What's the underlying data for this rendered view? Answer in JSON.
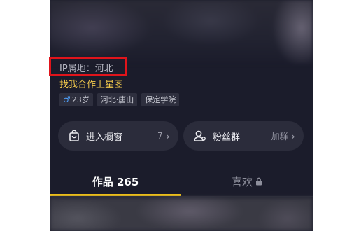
{
  "profile": {
    "ip_location": "IP属地：河北",
    "bio": "找我合作上星图",
    "tags": [
      {
        "icon": "male-icon",
        "text": "23岁"
      },
      {
        "text": "河北·唐山"
      },
      {
        "text": "保定学院"
      }
    ]
  },
  "cards": {
    "showcase": {
      "icon": "shopping-bag-icon",
      "label": "进入橱窗",
      "count": "7",
      "chevron": "›"
    },
    "fan_group": {
      "icon": "group-icon",
      "label": "粉丝群",
      "action": "加群",
      "chevron": "›"
    }
  },
  "tabs": [
    {
      "label": "作品 265",
      "active": true
    },
    {
      "label": "喜欢",
      "icon": "lock-icon",
      "active": false
    }
  ],
  "colors": {
    "background": "#1b1c2b",
    "bio": "#f2c94c",
    "tab_indicator": "#f5c518",
    "highlight_box": "#e0141b",
    "gender_icon": "#4fa3ff"
  }
}
